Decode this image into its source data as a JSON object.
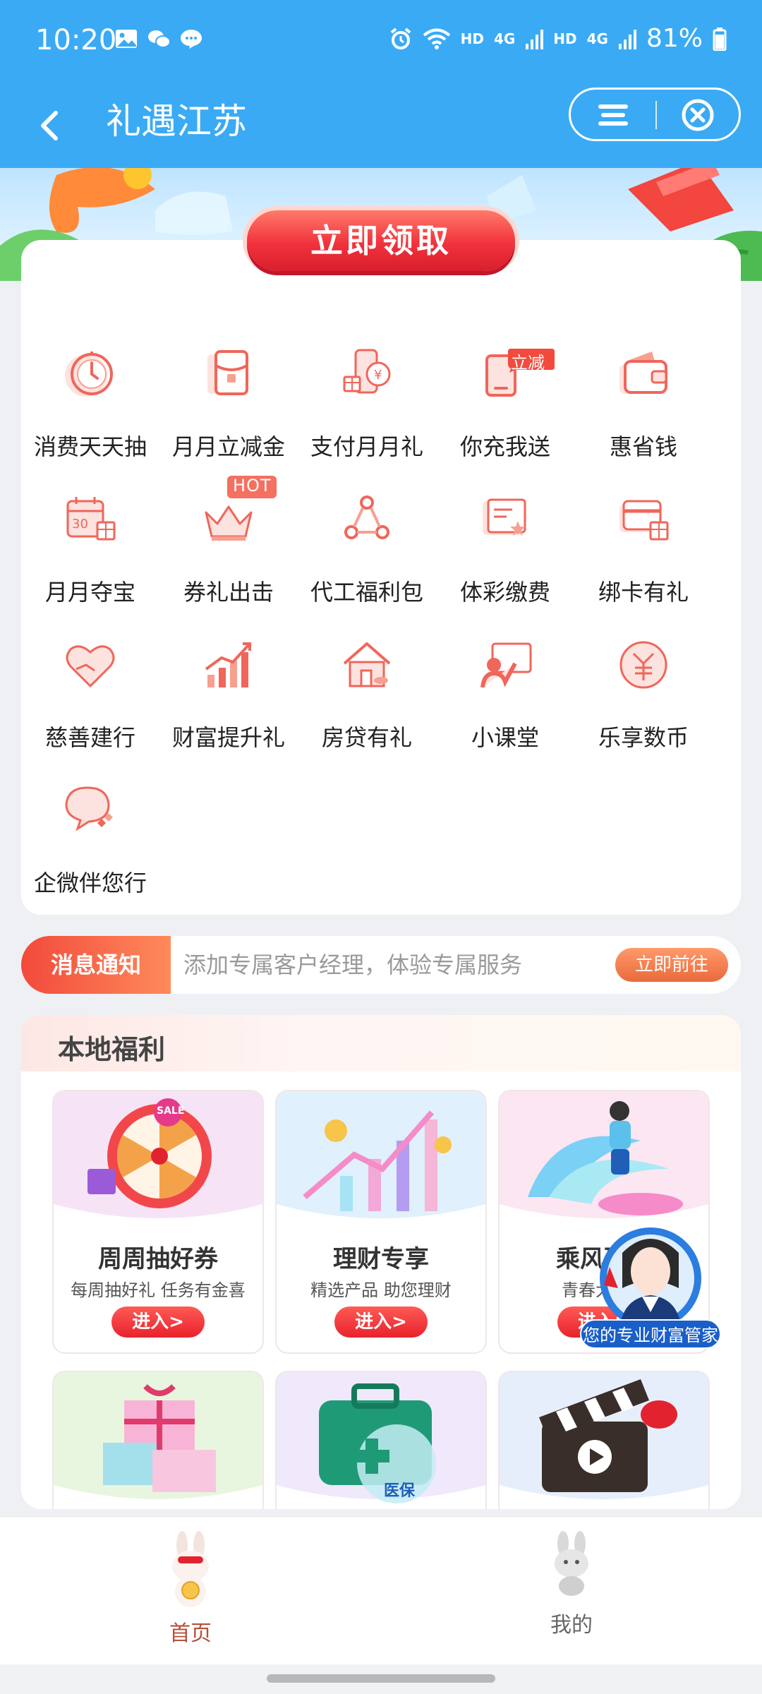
{
  "status_bar": {
    "time": "10:20",
    "hd1": "HD",
    "hd2": "HD",
    "net1": "4G",
    "net2": "4G",
    "battery": "81%"
  },
  "header": {
    "title": "礼遇江苏"
  },
  "banner": {
    "claim_label": "立即领取"
  },
  "grid": {
    "items": [
      {
        "label": "消费天天抽",
        "icon": "spin-dial-icon"
      },
      {
        "label": "月月立减金",
        "icon": "red-envelope-icon"
      },
      {
        "label": "支付月月礼",
        "icon": "phone-yen-gift-icon"
      },
      {
        "label": "你充我送",
        "icon": "phone-topup-icon",
        "badge": "立减"
      },
      {
        "label": "惠省钱",
        "icon": "wallet-icon"
      },
      {
        "label": "月月夺宝",
        "icon": "calendar-gift-icon"
      },
      {
        "label": "券礼出击",
        "icon": "crown-icon",
        "badge": "HOT"
      },
      {
        "label": "代工福利包",
        "icon": "people-network-icon"
      },
      {
        "label": "体彩缴费",
        "icon": "lottery-ticket-icon"
      },
      {
        "label": "绑卡有礼",
        "icon": "card-gift-icon"
      },
      {
        "label": "慈善建行",
        "icon": "heart-hands-icon"
      },
      {
        "label": "财富提升礼",
        "icon": "growth-chart-icon"
      },
      {
        "label": "房贷有礼",
        "icon": "house-icon"
      },
      {
        "label": "小课堂",
        "icon": "teacher-board-icon"
      },
      {
        "label": "乐享数币",
        "icon": "digital-yuan-icon"
      },
      {
        "label": "企微伴您行",
        "icon": "chat-bubble-icon"
      }
    ]
  },
  "notice": {
    "tag": "消息通知",
    "text": "添加专属客户经理，体验专属服务",
    "button": "立即前往"
  },
  "local": {
    "title": "本地福利",
    "cards": [
      {
        "title": "周周抽好券",
        "subtitle": "每周抽好礼 任务有金喜",
        "enter": "进入>",
        "icon": "prize-wheel-icon",
        "sale": "SALE"
      },
      {
        "title": "理财专享",
        "subtitle": "精选产品 助您理财",
        "enter": "进入>",
        "icon": "finance-growth-icon"
      },
      {
        "title": "乘风破浪",
        "subtitle": "青春大冒险",
        "enter": "进入>",
        "icon": "surfer-icon"
      },
      {
        "title": "",
        "subtitle": "",
        "enter": "",
        "icon": "gift-boxes-icon"
      },
      {
        "title": "",
        "subtitle": "",
        "enter": "",
        "icon": "medical-kit-icon",
        "tag": "医保"
      },
      {
        "title": "",
        "subtitle": "",
        "enter": "",
        "icon": "clapperboard-icon"
      }
    ]
  },
  "advisor": {
    "label": "您的专业财富管家"
  },
  "tabs": [
    {
      "label": "首页",
      "active": true,
      "color": "#b5503a"
    },
    {
      "label": "我的",
      "active": false,
      "color": "#666666"
    }
  ],
  "colors": {
    "header": "#3aaaf5",
    "accent": "#e8222c"
  }
}
